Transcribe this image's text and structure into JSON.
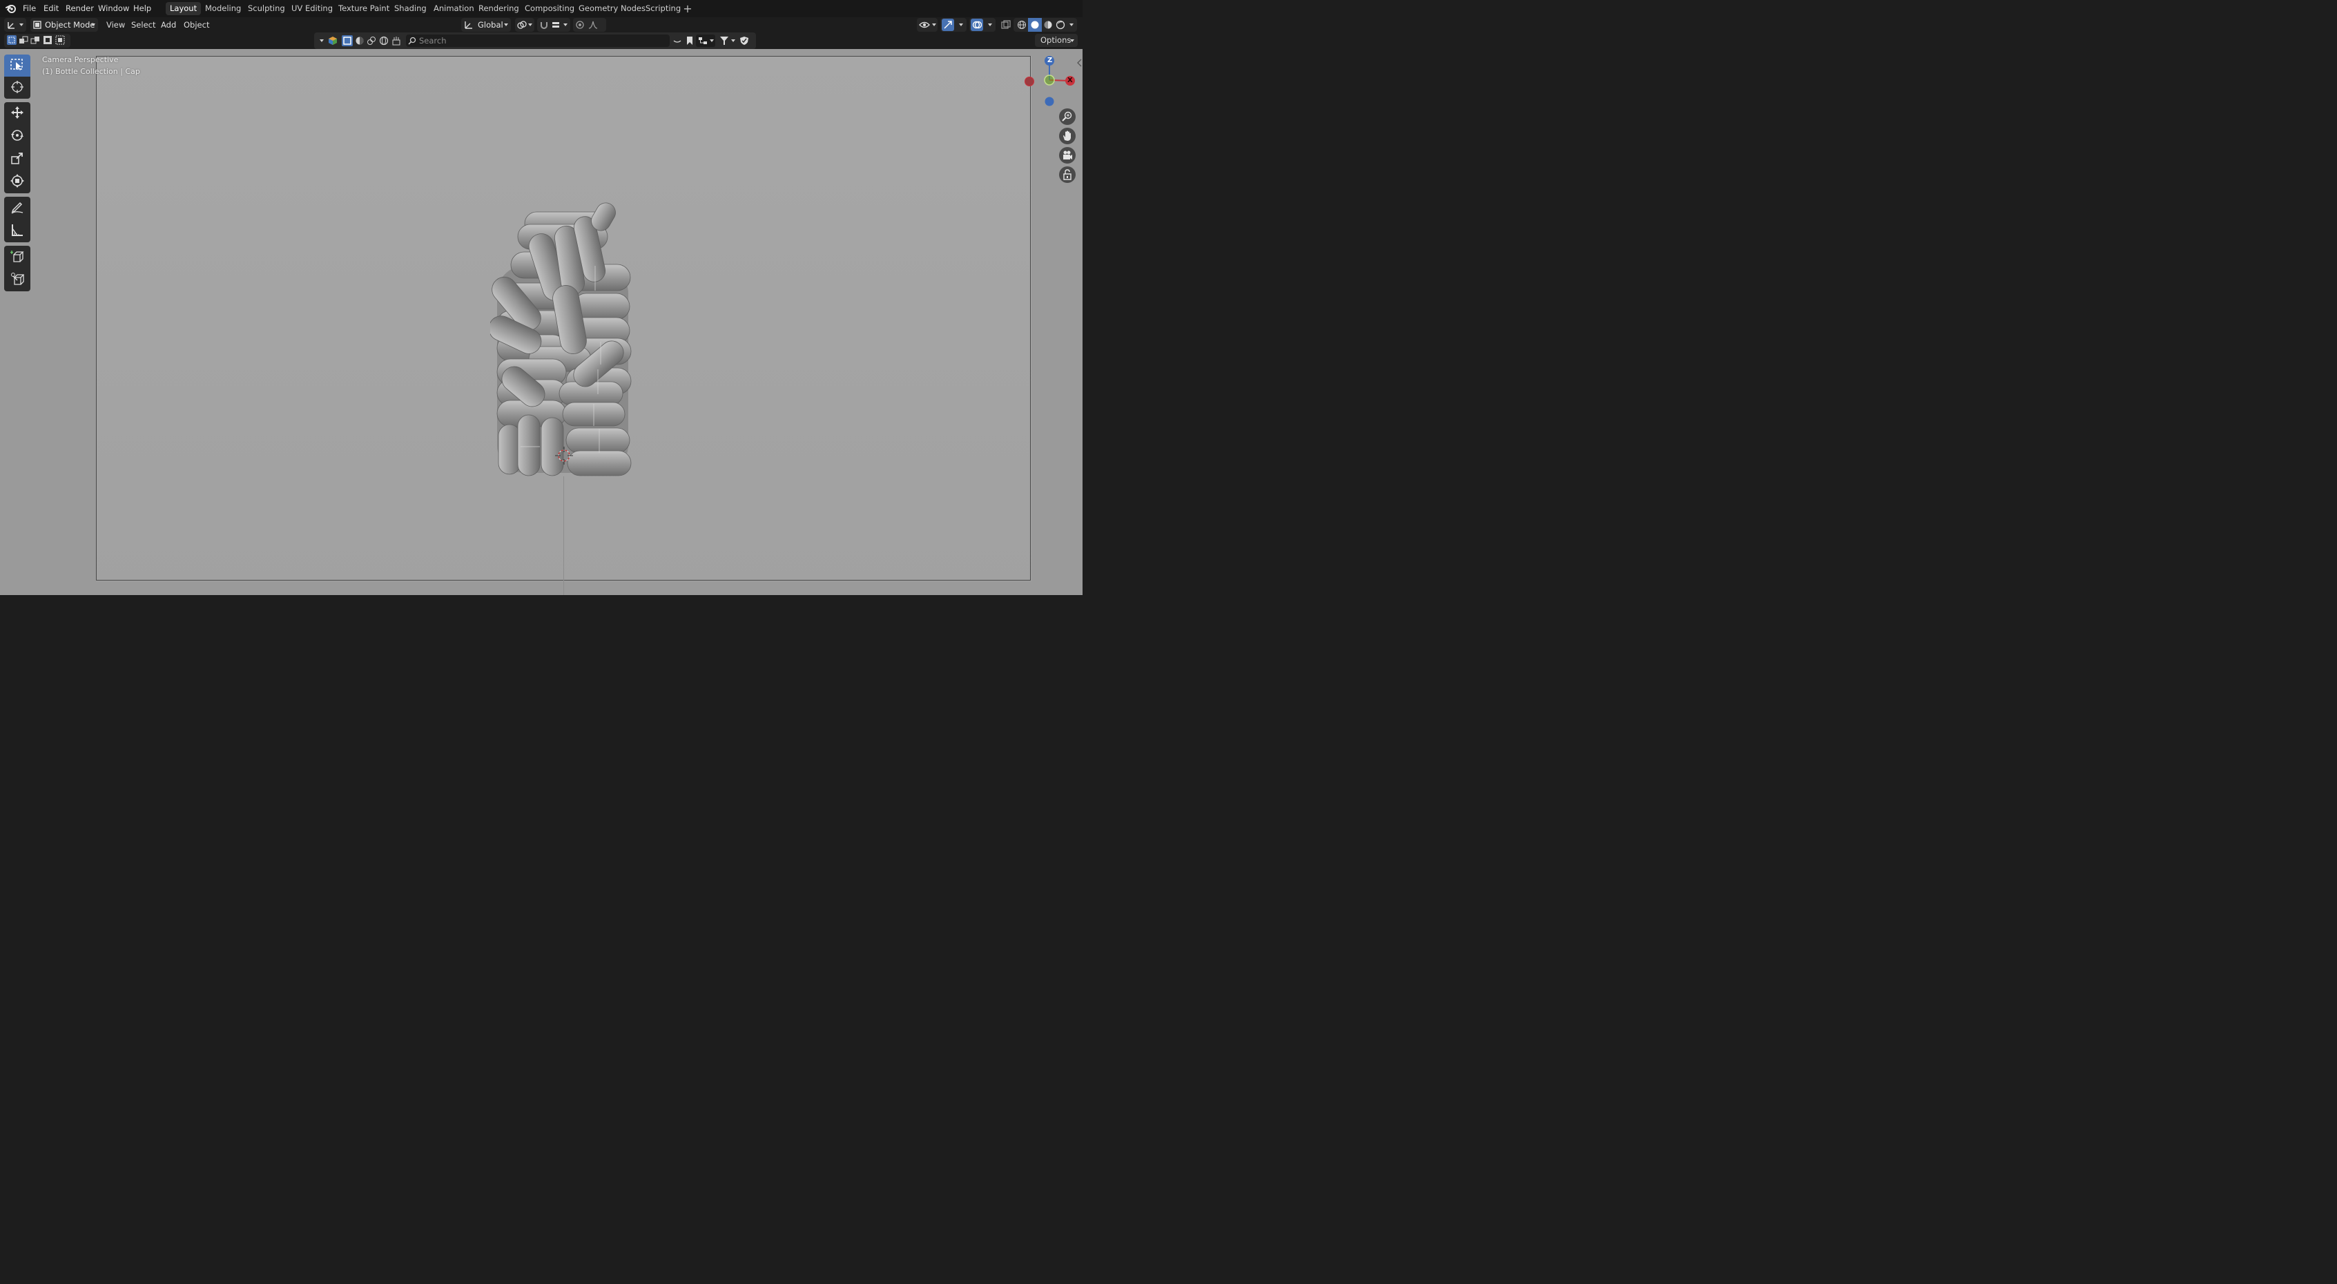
{
  "app": {
    "name": "Blender"
  },
  "menu": [
    "File",
    "Edit",
    "Render",
    "Window",
    "Help"
  ],
  "workspaces": [
    {
      "label": "Layout",
      "active": true
    },
    {
      "label": "Modeling",
      "active": false
    },
    {
      "label": "Sculpting",
      "active": false
    },
    {
      "label": "UV Editing",
      "active": false
    },
    {
      "label": "Texture Paint",
      "active": false
    },
    {
      "label": "Shading",
      "active": false
    },
    {
      "label": "Animation",
      "active": false
    },
    {
      "label": "Rendering",
      "active": false
    },
    {
      "label": "Compositing",
      "active": false
    },
    {
      "label": "Geometry Nodes",
      "active": false
    },
    {
      "label": "Scripting",
      "active": false
    }
  ],
  "header": {
    "mode": "Object Mode",
    "view": "View",
    "select": "Select",
    "add": "Add",
    "object": "Object",
    "orientation": "Global"
  },
  "outliner_bar": {
    "search_placeholder": "Search"
  },
  "options_label": "Options",
  "viewport": {
    "view_name": "Camera Perspective",
    "collection_info": "(1) Bottle Collection | Cap"
  },
  "gizmo": {
    "z": "Z",
    "x": "X"
  },
  "colors": {
    "accent": "#4772b3",
    "x_axis": "#c8323c",
    "y_axis": "#6aa321",
    "z_axis": "#3d6bb8"
  },
  "tools": [
    "select-box",
    "cursor",
    "move",
    "rotate",
    "scale",
    "transform",
    "annotate",
    "measure",
    "add-cube",
    "knife"
  ]
}
